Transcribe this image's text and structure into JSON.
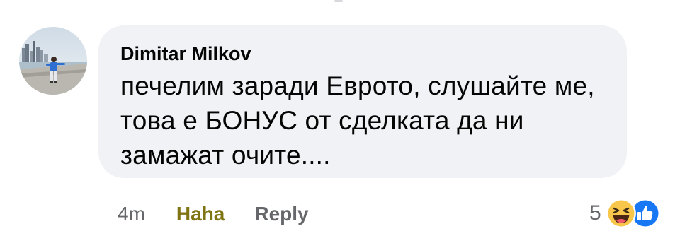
{
  "comment": {
    "author": "Dimitar Milkov",
    "text_lines": [
      "печелим заради Еврото, слушайте ме,",
      "това е БОНУС от сделката да ни",
      "замажат очите...."
    ]
  },
  "actions": {
    "time": "4m",
    "haha_label": "Haha",
    "reply_label": "Reply"
  },
  "reactions": {
    "count": "5",
    "icons": [
      "haha-emoji-icon",
      "like-thumb-icon"
    ],
    "colors": {
      "haha_yellow": "#f7c64a",
      "like_blue": "#1877f2",
      "haha_text": "#7f7412"
    }
  }
}
